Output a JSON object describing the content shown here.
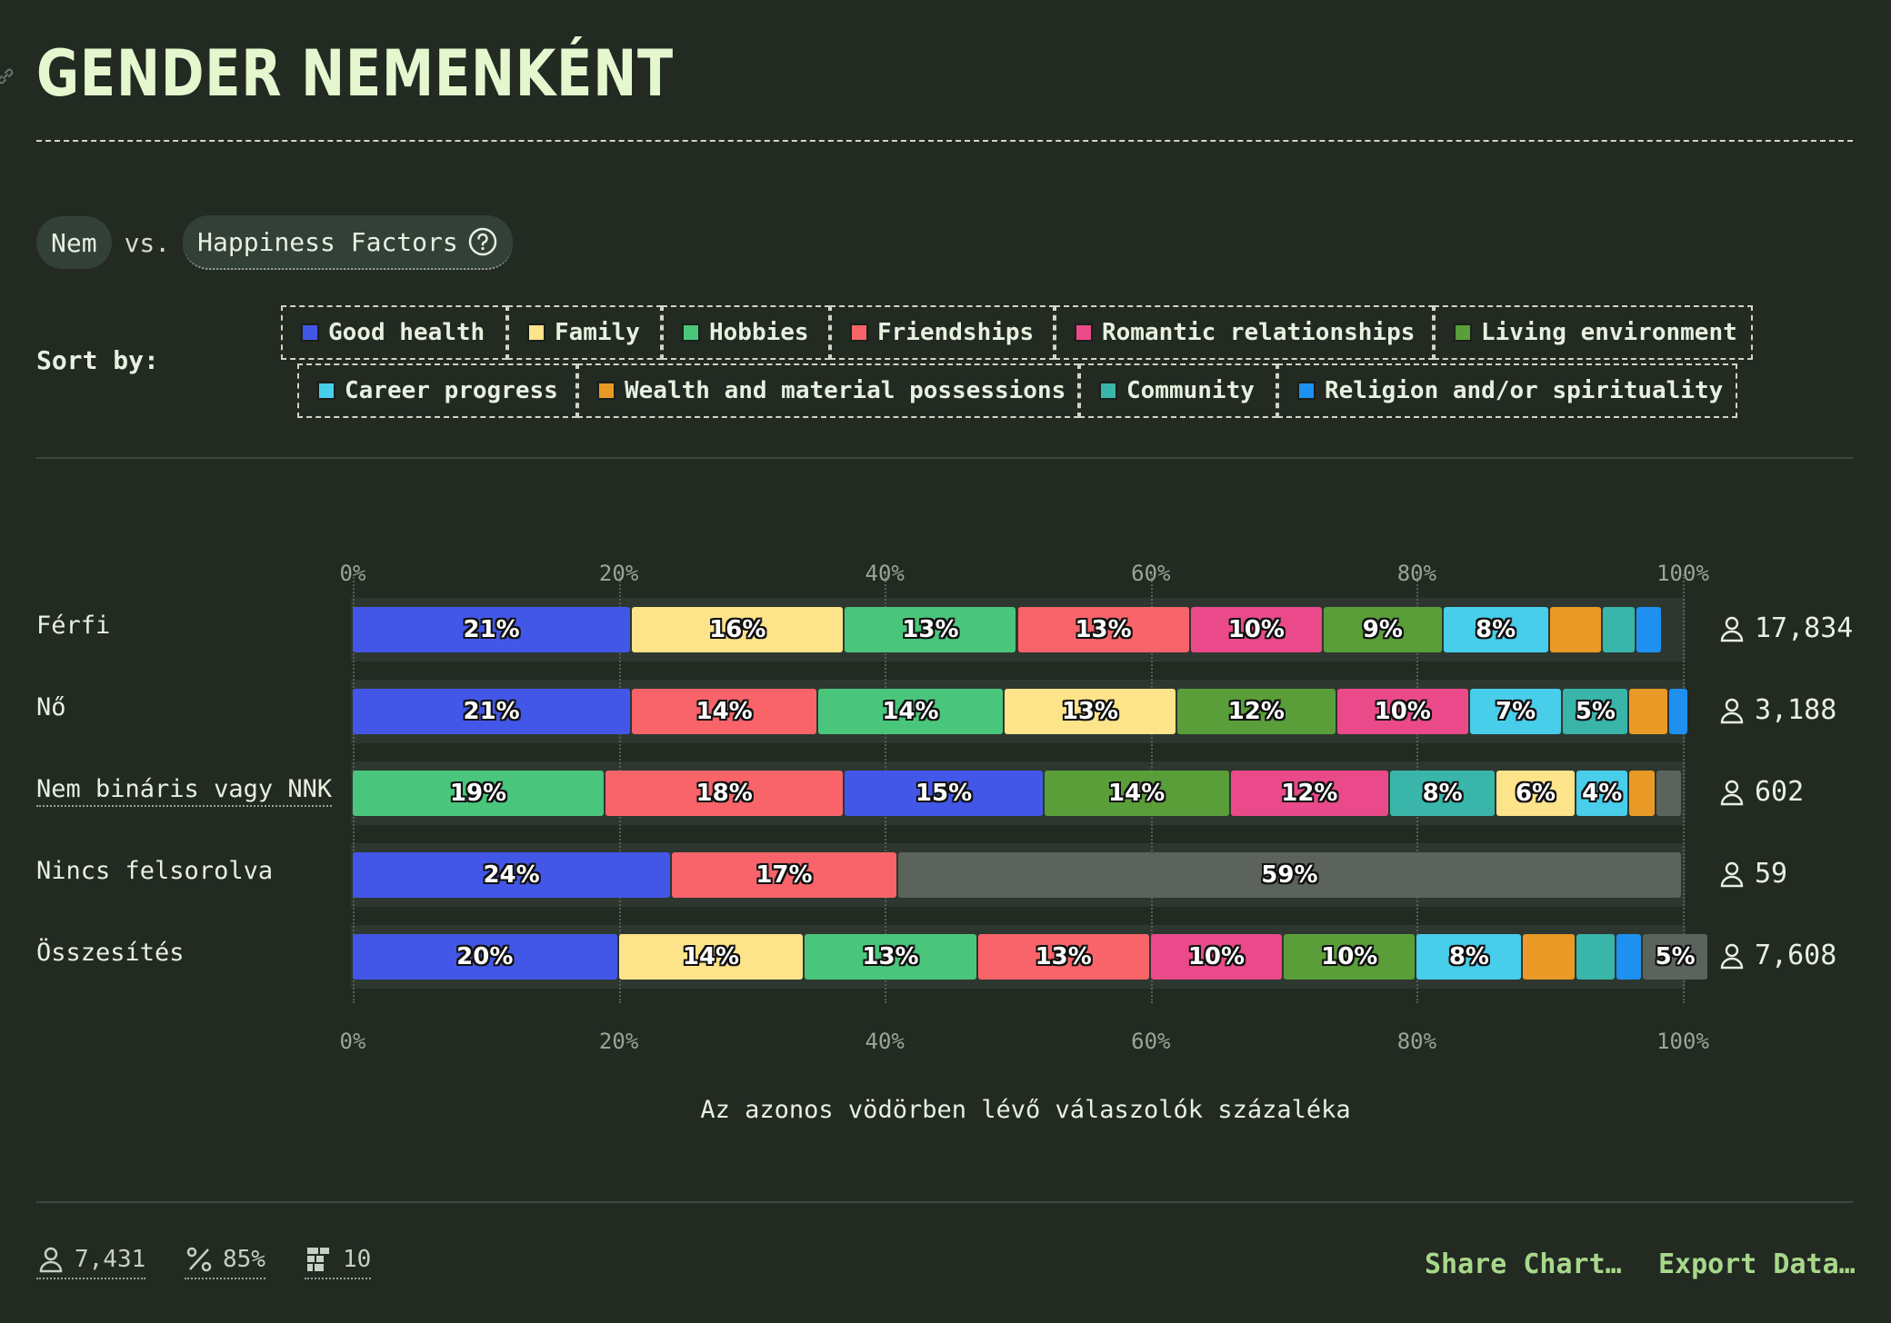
{
  "title": "GENDER NEMENKÉNT",
  "comparison": {
    "dimension": "Nem",
    "vs": "vs.",
    "factor": "Happiness Factors"
  },
  "sort_by_label": "Sort by:",
  "categories": [
    {
      "key": "good_health",
      "label": "Good health",
      "color": "#4257e8"
    },
    {
      "key": "family",
      "label": "Family",
      "color": "#fde38a"
    },
    {
      "key": "hobbies",
      "label": "Hobbies",
      "color": "#4ac67c"
    },
    {
      "key": "friendships",
      "label": "Friendships",
      "color": "#f8646a"
    },
    {
      "key": "romantic",
      "label": "Romantic relationships",
      "color": "#ea4a8a"
    },
    {
      "key": "living",
      "label": "Living environment",
      "color": "#5a9e3a"
    },
    {
      "key": "career",
      "label": "Career progress",
      "color": "#48cdea"
    },
    {
      "key": "wealth",
      "label": "Wealth and material possessions",
      "color": "#e99a26"
    },
    {
      "key": "community",
      "label": "Community",
      "color": "#39b5aa"
    },
    {
      "key": "religion",
      "label": "Religion and/or spirituality",
      "color": "#1e90f0"
    }
  ],
  "other_color": "#5c635c",
  "chart_data": {
    "type": "bar",
    "orientation": "horizontal",
    "stacked": true,
    "xlim": [
      0,
      100
    ],
    "x_ticks": [
      "0%",
      "20%",
      "40%",
      "60%",
      "80%",
      "100%"
    ],
    "xlabel": "Az azonos vödörben lévő válaszolók százaléka",
    "rows": [
      {
        "label": "Férfi",
        "count": "17,834",
        "segments": [
          {
            "cat": "good_health",
            "value": 21,
            "label": "21%"
          },
          {
            "cat": "family",
            "value": 16,
            "label": "16%"
          },
          {
            "cat": "hobbies",
            "value": 13,
            "label": "13%"
          },
          {
            "cat": "friendships",
            "value": 13,
            "label": "13%"
          },
          {
            "cat": "romantic",
            "value": 10,
            "label": "10%"
          },
          {
            "cat": "living",
            "value": 9,
            "label": "9%"
          },
          {
            "cat": "career",
            "value": 8,
            "label": "8%"
          },
          {
            "cat": "wealth",
            "value": 4,
            "label": ""
          },
          {
            "cat": "community",
            "value": 2.5,
            "label": ""
          },
          {
            "cat": "religion",
            "value": 2,
            "label": ""
          }
        ]
      },
      {
        "label": "Nő",
        "count": "3,188",
        "segments": [
          {
            "cat": "good_health",
            "value": 21,
            "label": "21%"
          },
          {
            "cat": "friendships",
            "value": 14,
            "label": "14%"
          },
          {
            "cat": "hobbies",
            "value": 14,
            "label": "14%"
          },
          {
            "cat": "family",
            "value": 13,
            "label": "13%"
          },
          {
            "cat": "living",
            "value": 12,
            "label": "12%"
          },
          {
            "cat": "romantic",
            "value": 10,
            "label": "10%"
          },
          {
            "cat": "career",
            "value": 7,
            "label": "7%"
          },
          {
            "cat": "community",
            "value": 5,
            "label": "5%"
          },
          {
            "cat": "wealth",
            "value": 3,
            "label": ""
          },
          {
            "cat": "religion",
            "value": 1.5,
            "label": ""
          }
        ]
      },
      {
        "label": "Nem bináris vagy NNK",
        "underlined": true,
        "count": "602",
        "segments": [
          {
            "cat": "hobbies",
            "value": 19,
            "label": "19%"
          },
          {
            "cat": "friendships",
            "value": 18,
            "label": "18%"
          },
          {
            "cat": "good_health",
            "value": 15,
            "label": "15%"
          },
          {
            "cat": "living",
            "value": 14,
            "label": "14%"
          },
          {
            "cat": "romantic",
            "value": 12,
            "label": "12%"
          },
          {
            "cat": "community",
            "value": 8,
            "label": "8%"
          },
          {
            "cat": "family",
            "value": 6,
            "label": "6%"
          },
          {
            "cat": "career",
            "value": 4,
            "label": "4%"
          },
          {
            "cat": "wealth",
            "value": 2,
            "label": ""
          },
          {
            "cat": "other",
            "value": 2,
            "label": ""
          }
        ]
      },
      {
        "label": "Nincs felsorolva",
        "count": "59",
        "segments": [
          {
            "cat": "good_health",
            "value": 24,
            "label": "24%"
          },
          {
            "cat": "friendships",
            "value": 17,
            "label": "17%"
          },
          {
            "cat": "other",
            "value": 59,
            "label": "59%"
          }
        ]
      },
      {
        "label": "Összesítés",
        "count": "7,608",
        "segments": [
          {
            "cat": "good_health",
            "value": 20,
            "label": "20%"
          },
          {
            "cat": "family",
            "value": 14,
            "label": "14%"
          },
          {
            "cat": "hobbies",
            "value": 13,
            "label": "13%"
          },
          {
            "cat": "friendships",
            "value": 13,
            "label": "13%"
          },
          {
            "cat": "romantic",
            "value": 10,
            "label": "10%"
          },
          {
            "cat": "living",
            "value": 10,
            "label": "10%"
          },
          {
            "cat": "career",
            "value": 8,
            "label": "8%"
          },
          {
            "cat": "wealth",
            "value": 4,
            "label": ""
          },
          {
            "cat": "community",
            "value": 3,
            "label": ""
          },
          {
            "cat": "religion",
            "value": 2,
            "label": ""
          },
          {
            "cat": "other",
            "value": 5,
            "label": "5%"
          }
        ]
      }
    ]
  },
  "footer": {
    "respondents": "7,431",
    "percent": "85%",
    "factors": "10",
    "share_label": "Share Chart…",
    "export_label": "Export Data…"
  }
}
